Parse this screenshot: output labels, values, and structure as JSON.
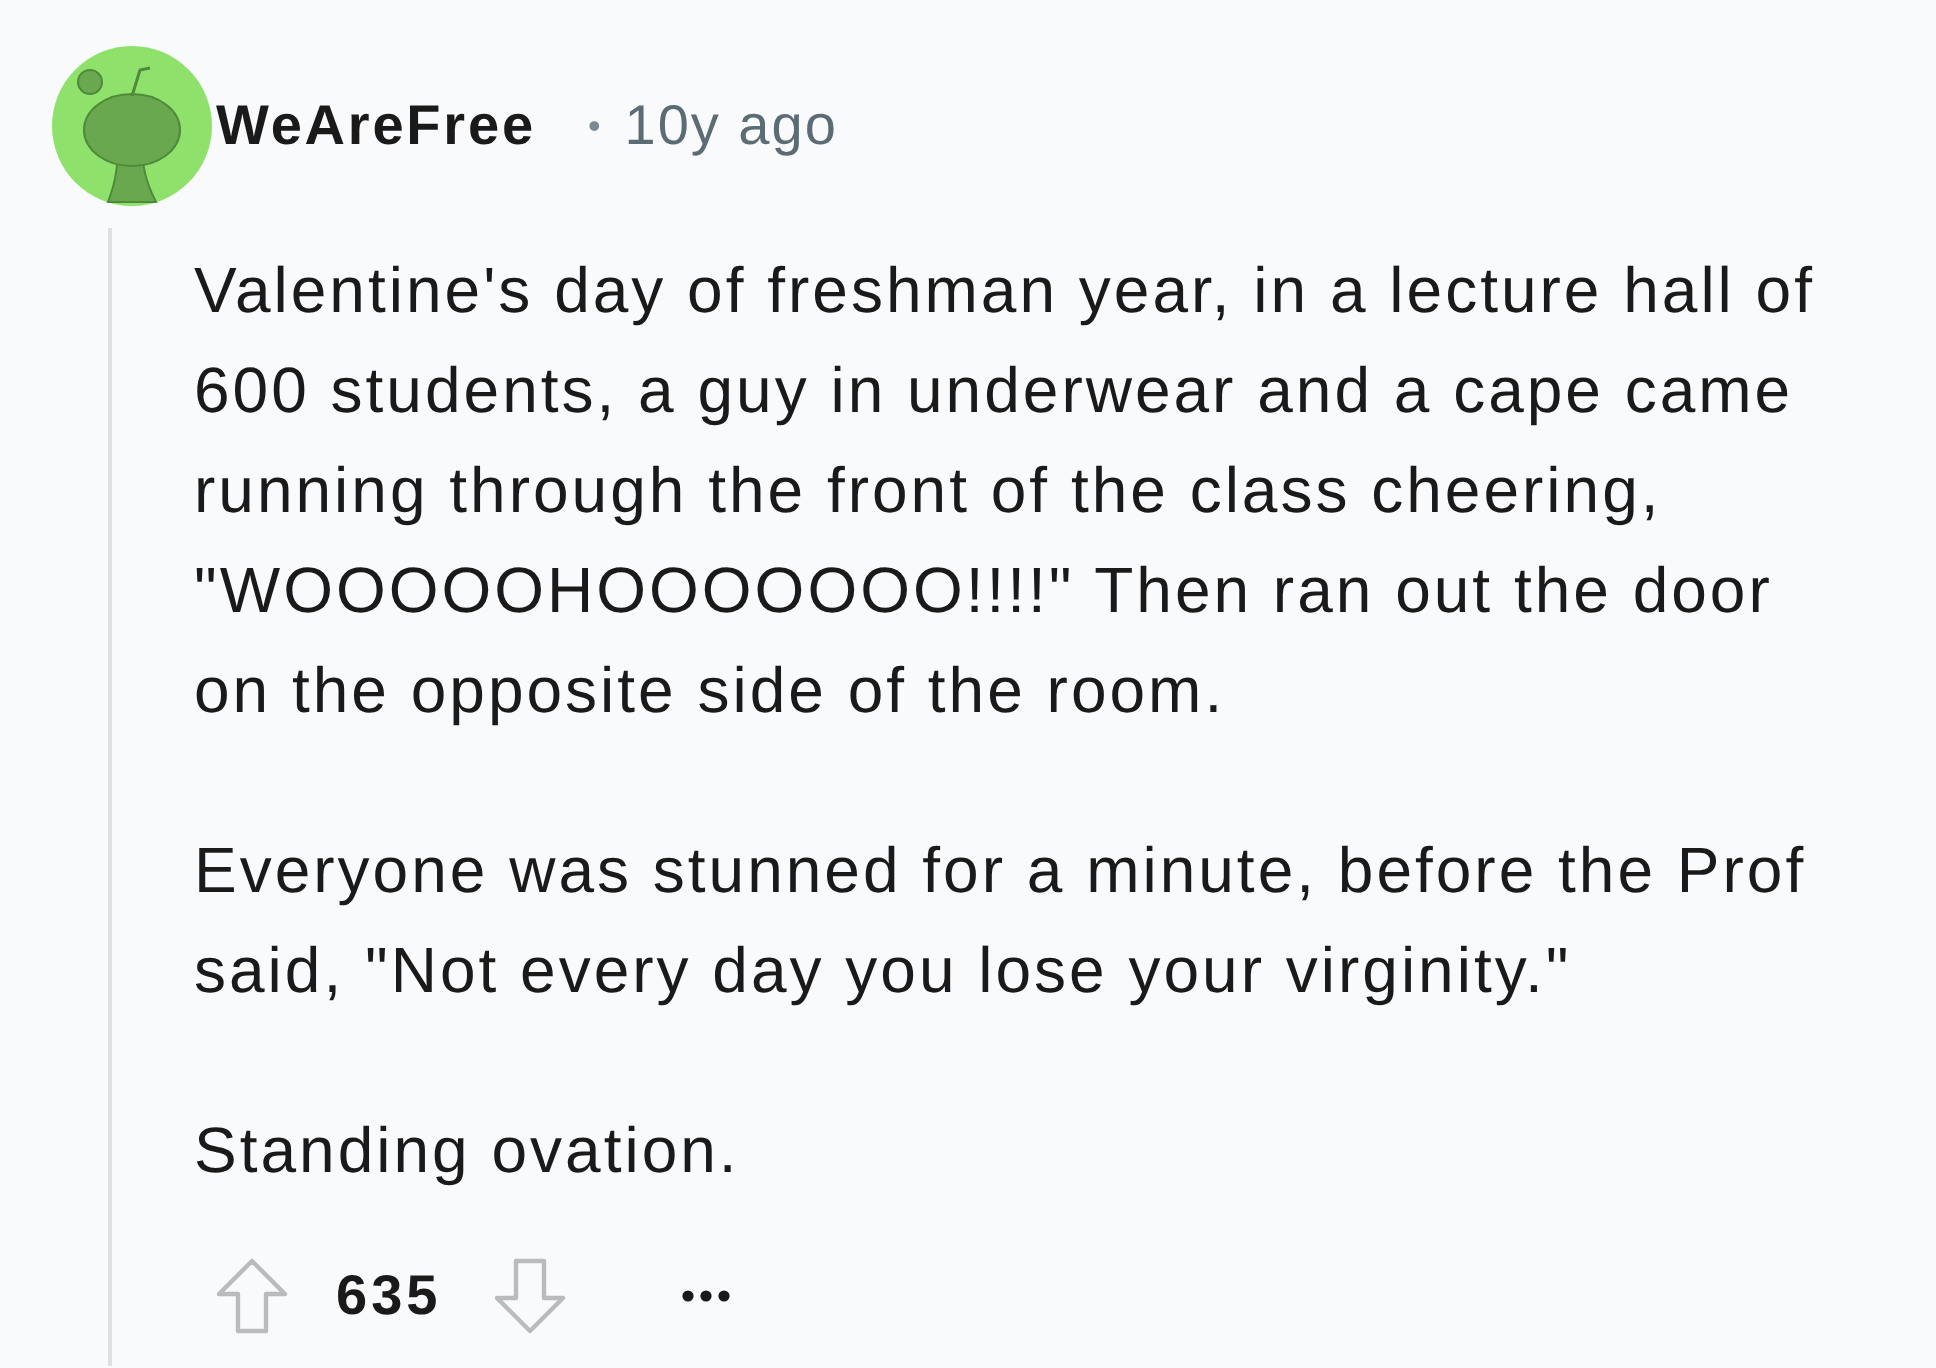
{
  "comment": {
    "author": "WeAreFree",
    "separator": "•",
    "time": "10y ago",
    "paragraphs": [
      "Valentine's day of freshman year, in a lecture hall of 600 students, a guy in underwear and a cape came running through the front of the class cheering, \"WOOOOOHOOOOOOO!!!!\" Then ran out the door on the opposite side of the room.",
      "Everyone was stunned for a minute, before the Prof said, \"Not every day you lose your virginity.\"",
      "Standing ovation."
    ],
    "score": "635"
  }
}
